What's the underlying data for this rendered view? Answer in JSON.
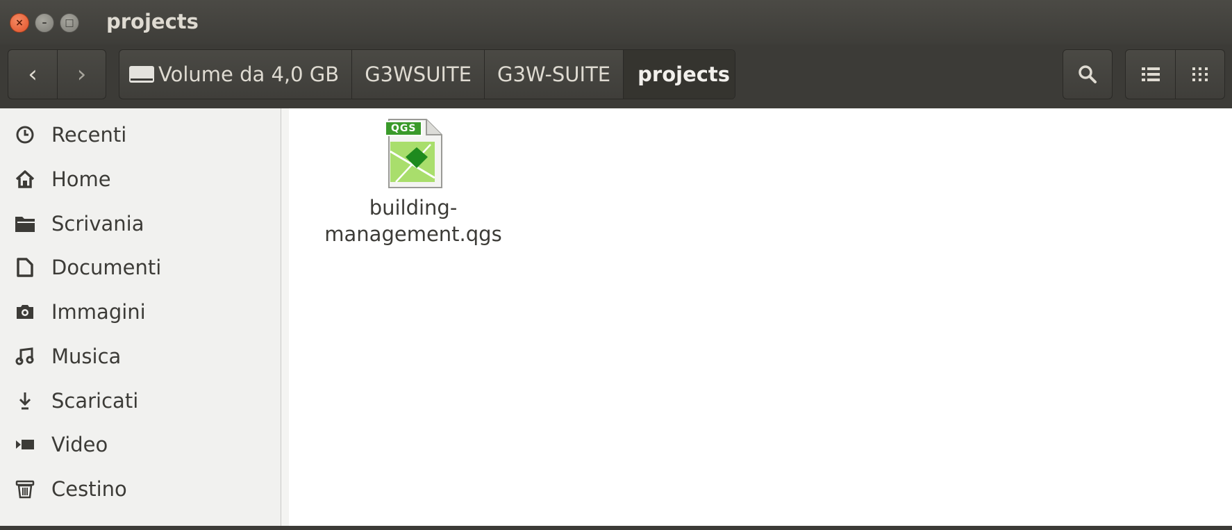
{
  "window": {
    "title": "projects",
    "controls": {
      "close": "×",
      "minimize": "–",
      "maximize": "□"
    }
  },
  "toolbar": {
    "back_icon": "‹",
    "forward_icon": "›",
    "breadcrumbs": [
      "Volume da 4,0 GB",
      "G3WSUITE",
      "G3W-SUITE",
      "projects"
    ],
    "search_icon": "search-icon",
    "list_view_icon": "list-view-icon",
    "grid_view_icon": "grid-view-icon"
  },
  "sidebar": {
    "items": [
      {
        "label": "Recenti",
        "icon": "clock-icon"
      },
      {
        "label": "Home",
        "icon": "home-icon"
      },
      {
        "label": "Scrivania",
        "icon": "folder-icon"
      },
      {
        "label": "Documenti",
        "icon": "document-icon"
      },
      {
        "label": "Immagini",
        "icon": "camera-icon"
      },
      {
        "label": "Musica",
        "icon": "music-icon"
      },
      {
        "label": "Scaricati",
        "icon": "download-icon"
      },
      {
        "label": "Video",
        "icon": "video-icon"
      },
      {
        "label": "Cestino",
        "icon": "trash-icon"
      }
    ]
  },
  "files": [
    {
      "name_line1": "building-",
      "name_line2": "management.qgs",
      "badge": "QGS",
      "icon": "qgs-file-icon"
    }
  ],
  "colors": {
    "accent": "#e0522a",
    "qgs_green": "#3a9a2a"
  }
}
